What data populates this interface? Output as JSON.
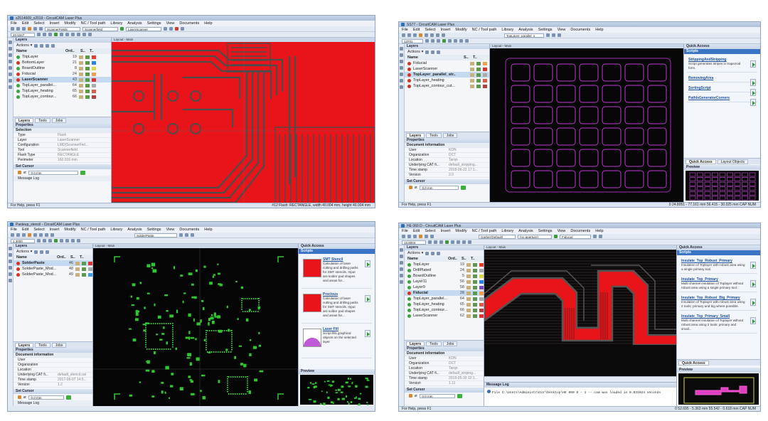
{
  "windows": {
    "w1": {
      "title": "s2514009_v2019 - CircuitCAM Laser Plus",
      "menu": [
        "File",
        "Edit",
        "Select",
        "Insert",
        "Modify",
        "NC / Tool path",
        "Library",
        "Analysis",
        "Settings",
        "View",
        "Documents",
        "Help"
      ],
      "toolbar_combos": [
        "ScannerFields",
        "Scannerfield",
        "LaserScanner"
      ],
      "coord_readout": "20.5347",
      "layers_title": "Layers",
      "layers_header": [
        "Name",
        "Ord..",
        "S..",
        "T.."
      ],
      "layers": [
        {
          "name": "TopLayer",
          "order": "19",
          "color": "#e8392a",
          "state": "green"
        },
        {
          "name": "BottomLayer",
          "order": "21",
          "color": "#2a7fe8",
          "state": "red"
        },
        {
          "name": "BoardOutline",
          "order": "8",
          "color": "#d8d84a",
          "state": "green"
        },
        {
          "name": "Fiducial",
          "order": "24",
          "color": "#f0a050",
          "state": "red"
        },
        {
          "name": "LaserScanner",
          "order": "43",
          "color": "#e03232",
          "state": "red",
          "selected": true
        },
        {
          "name": "TopLayer_parallel...",
          "order": "64",
          "color": "#aaaaaa",
          "state": "green"
        },
        {
          "name": "TopLayer_heating",
          "order": "65",
          "color": "#e05a4a",
          "state": "green"
        },
        {
          "name": "TopLayer_contour...",
          "order": "66",
          "color": "#b04040",
          "state": "green"
        }
      ],
      "tabs": [
        "Layers",
        "Tools",
        "Jobs"
      ],
      "props_title": "Properties",
      "props": [
        {
          "k": "Selection",
          "v": "",
          "hd": true
        },
        {
          "k": "Type",
          "v": "Flash"
        },
        {
          "k": "Layer",
          "v": "LaserScanner"
        },
        {
          "k": "Configuration",
          "v": "LMD(ScannerFiel..."
        },
        {
          "k": "Tool",
          "v": "Scannerfield"
        },
        {
          "k": "Flash Type",
          "v": "RECTANGLE"
        },
        {
          "k": "Perimeter",
          "v": "160.016 mm"
        }
      ],
      "cursor_title": "Set Cursor",
      "cursor_value": "0.0 mm",
      "message_log": "Message Log",
      "layout_title": "Layout - Main",
      "status_left": "For Help, press F1",
      "status_right": "#12 Flash: RECTANGLE, width 40.004 mm, height 40.004 mm"
    },
    "w2": {
      "title": "SS77 - CircuitCAM Laser Plus",
      "menu": [
        "File",
        "Edit",
        "Select",
        "Insert",
        "Modify",
        "NC / Tool path",
        "Library",
        "Analysis",
        "Settings",
        "View",
        "Documents",
        "Help"
      ],
      "toolbar_combos": [
        "TopLayer_parallel_s"
      ],
      "coord_readout": "13701",
      "layers_title": "Layers",
      "layers_header": [
        "Name",
        "S..",
        "T.."
      ],
      "layers": [
        {
          "name": "Fiducial",
          "order": "",
          "color": "#f0a050",
          "state": "red"
        },
        {
          "name": "LaserScanner",
          "order": "",
          "color": "#e03232",
          "state": "red"
        },
        {
          "name": "TopLayer_parallel_str...",
          "order": "",
          "color": "#aaaaaa",
          "state": "red",
          "selected": true
        },
        {
          "name": "TopLayer_heating",
          "order": "",
          "color": "#e05a4a",
          "state": "red"
        },
        {
          "name": "TopLayer_contour_cut...",
          "order": "",
          "color": "#b04040",
          "state": "red"
        }
      ],
      "tabs": [
        "Layers",
        "Tools",
        "Jobs"
      ],
      "props_title": "Properties",
      "props": [
        {
          "k": "Document information",
          "v": "",
          "hd": true
        },
        {
          "k": "User",
          "v": "KDN"
        },
        {
          "k": "Organization",
          "v": "DCT"
        },
        {
          "k": "Location",
          "v": "Tarqn"
        },
        {
          "k": "Underlying CAT fi...",
          "v": "default_stripping..."
        },
        {
          "k": "Time stamp",
          "v": "2018-06-22 17:1..."
        },
        {
          "k": "Version",
          "v": "2.0"
        }
      ],
      "cursor_title": "Set Cursor",
      "cursor_value": "0.0 mm",
      "layout_title": "Layout - Main",
      "qa_title": "Quick Access",
      "scripts_title": "Scripts",
      "scripts": [
        {
          "t": "StrippingAndStripping",
          "d": "Script generates stripes in trapezoid form."
        },
        {
          "t": "RemovingArea",
          "d": ""
        },
        {
          "t": "SortingScript",
          "d": ""
        },
        {
          "t": "PathIsGeneratorCorners",
          "d": ""
        }
      ],
      "qa_tabs": [
        "Quick Access",
        "Layout Objects"
      ],
      "preview_title": "Preview",
      "status_left": "For Help, press F1",
      "status_right": "0      24.8051 - 77.161 mm      56.415 - 30.025 mm  CAP  NUM"
    },
    "w3": {
      "title": "Pasteup_stencil - CircuitCAM Laser Plus",
      "menu": [
        "File",
        "Edit",
        "Select",
        "Insert",
        "Modify",
        "NC / Tool path",
        "Library",
        "Analysis",
        "Settings",
        "View",
        "Documents",
        "Help"
      ],
      "toolbar_combos": [
        "SolderPaste"
      ],
      "coord_readout": "1.3000",
      "layers_title": "Layers",
      "layers_header": [
        "Name",
        "Ord..",
        "S..",
        "T.."
      ],
      "layers": [
        {
          "name": "SolderPaste",
          "order": "46",
          "color": "#e03232",
          "state": "red",
          "selected": true
        },
        {
          "name": "SolderPaste_Mod...",
          "order": "48",
          "color": "#aaaaaa",
          "state": "red"
        },
        {
          "name": "SolderPaste_Mod...",
          "order": "49",
          "color": "#3aa0e0",
          "state": "red"
        }
      ],
      "tabs": [
        "Layers",
        "Tools",
        "Jobs"
      ],
      "props_title": "Properties",
      "props": [
        {
          "k": "Document information",
          "v": "",
          "hd": true
        },
        {
          "k": "User",
          "v": ""
        },
        {
          "k": "Organization",
          "v": ""
        },
        {
          "k": "Location",
          "v": ""
        },
        {
          "k": "Underlying CAT fi...",
          "v": "default_stencil.cat"
        },
        {
          "k": "Time stamp",
          "v": "2017-06-07 14:5..."
        },
        {
          "k": "Version",
          "v": "1.2"
        }
      ],
      "cursor_title": "Set Cursor",
      "cursor_value": "0.0 mm",
      "message_log": "Message Log",
      "layout_title": "Layout - Main",
      "qa_title": "Quick Access",
      "scripts_title": "Scripts",
      "scripts": [
        {
          "t": "SMT Stencil",
          "d": "Calculation of laser cutting and drilling paths for SMT stencils. Input are solder pad shapes and areas for..."
        },
        {
          "t": "Precious",
          "d": "Calculation of laser cutting and drilling paths for SMT stencils. Input are solder pad shapes and areas for..."
        },
        {
          "t": "Laser Fill",
          "d": "Script fills graphical objects on the selected layer"
        }
      ],
      "preview_title": "Preview"
    },
    "w4": {
      "title": "HE 060 D - CircuitCAM Laser Plus",
      "menu": [
        "File",
        "Edit",
        "Select",
        "Insert",
        "Modify",
        "NC / Tool path",
        "Library",
        "Analysis",
        "Settings",
        "View",
        "Documents",
        "Help"
      ],
      "toolbar_combos": [
        "Garber(Default)",
        "(no aperture)",
        "Fiducial"
      ],
      "coord_readout": "15.8004",
      "layers_title": "Layers",
      "layers_header": [
        "Name",
        "Ord..",
        "S..",
        "T.."
      ],
      "layers": [
        {
          "name": "TopLayer",
          "order": "19",
          "color": "#e8392a",
          "state": "green"
        },
        {
          "name": "DrillPlated",
          "order": "24",
          "color": "#aaaaaa",
          "state": "green"
        },
        {
          "name": "BoardOutline",
          "order": "5",
          "color": "#d8d84a",
          "state": "green"
        },
        {
          "name": "Layer11",
          "order": "56",
          "color": "#2a7fe8",
          "state": "green"
        },
        {
          "name": "Layer9",
          "order": "58",
          "color": "#7a4ac0",
          "state": "green"
        },
        {
          "name": "Fiducial",
          "order": "28",
          "color": "#f0a050",
          "state": "red",
          "selected": true
        },
        {
          "name": "TopLayer_parallel...",
          "order": "64",
          "color": "#aaaaaa",
          "state": "green"
        },
        {
          "name": "TopLayer_heating",
          "order": "65",
          "color": "#e05a4a",
          "state": "green"
        },
        {
          "name": "TopLayer_contour...",
          "order": "66",
          "color": "#b04040",
          "state": "green"
        },
        {
          "name": "LaserScanner",
          "order": "62",
          "color": "#e03232",
          "state": "green"
        }
      ],
      "tabs": [
        "Layers",
        "Tools",
        "Jobs"
      ],
      "props_title": "Properties",
      "props": [
        {
          "k": "Document information",
          "v": "",
          "hd": true
        },
        {
          "k": "User",
          "v": "KDN"
        },
        {
          "k": "Organization",
          "v": "DCT"
        },
        {
          "k": "Location",
          "v": "Tarqn"
        },
        {
          "k": "Underlying CAT fi...",
          "v": "default_striping..."
        },
        {
          "k": "Time stamp",
          "v": "2018-05-30 12:1..."
        },
        {
          "k": "Version",
          "v": "1.11"
        }
      ],
      "cursor_title": "Set Cursor",
      "cursor_value": "0.0 mm",
      "message_log": "Message Log",
      "message_line": "File C:\\Users\\Administrator\\Desktop\\HE 060 D - 1 --.cam was loaded in 0.031924 seconds",
      "layout_title": "Layout - Main",
      "qa_title": "Quick Access",
      "scripts_title": "Scripts",
      "scripts": [
        {
          "t": "Insulate_Top_Robust_Primary",
          "d": "Insulation of Toplayer with robust area using a single primary tool."
        },
        {
          "t": "Insulate_Top_Primary",
          "d": "Multi channel insulation of Toplayer without robust area using a single primary tool."
        },
        {
          "t": "Insulate_Top_Robust_Big_Primary",
          "d": "Insulation of Toplayer with robust area using 2 tools: primary and big where possible."
        },
        {
          "t": "Insulate_Top_Primary_Small",
          "d": "Multi channel insulation of Toplayer without robust area using 2 tools: primary and small..."
        }
      ],
      "qa_tabs": [
        "Quick Access"
      ],
      "preview_title": "Preview",
      "status_left": "For Help, press F1",
      "status_right": "0      52.695 - 5.363 mm      55.542 - 0.618 mm  CAP  NUM"
    }
  }
}
